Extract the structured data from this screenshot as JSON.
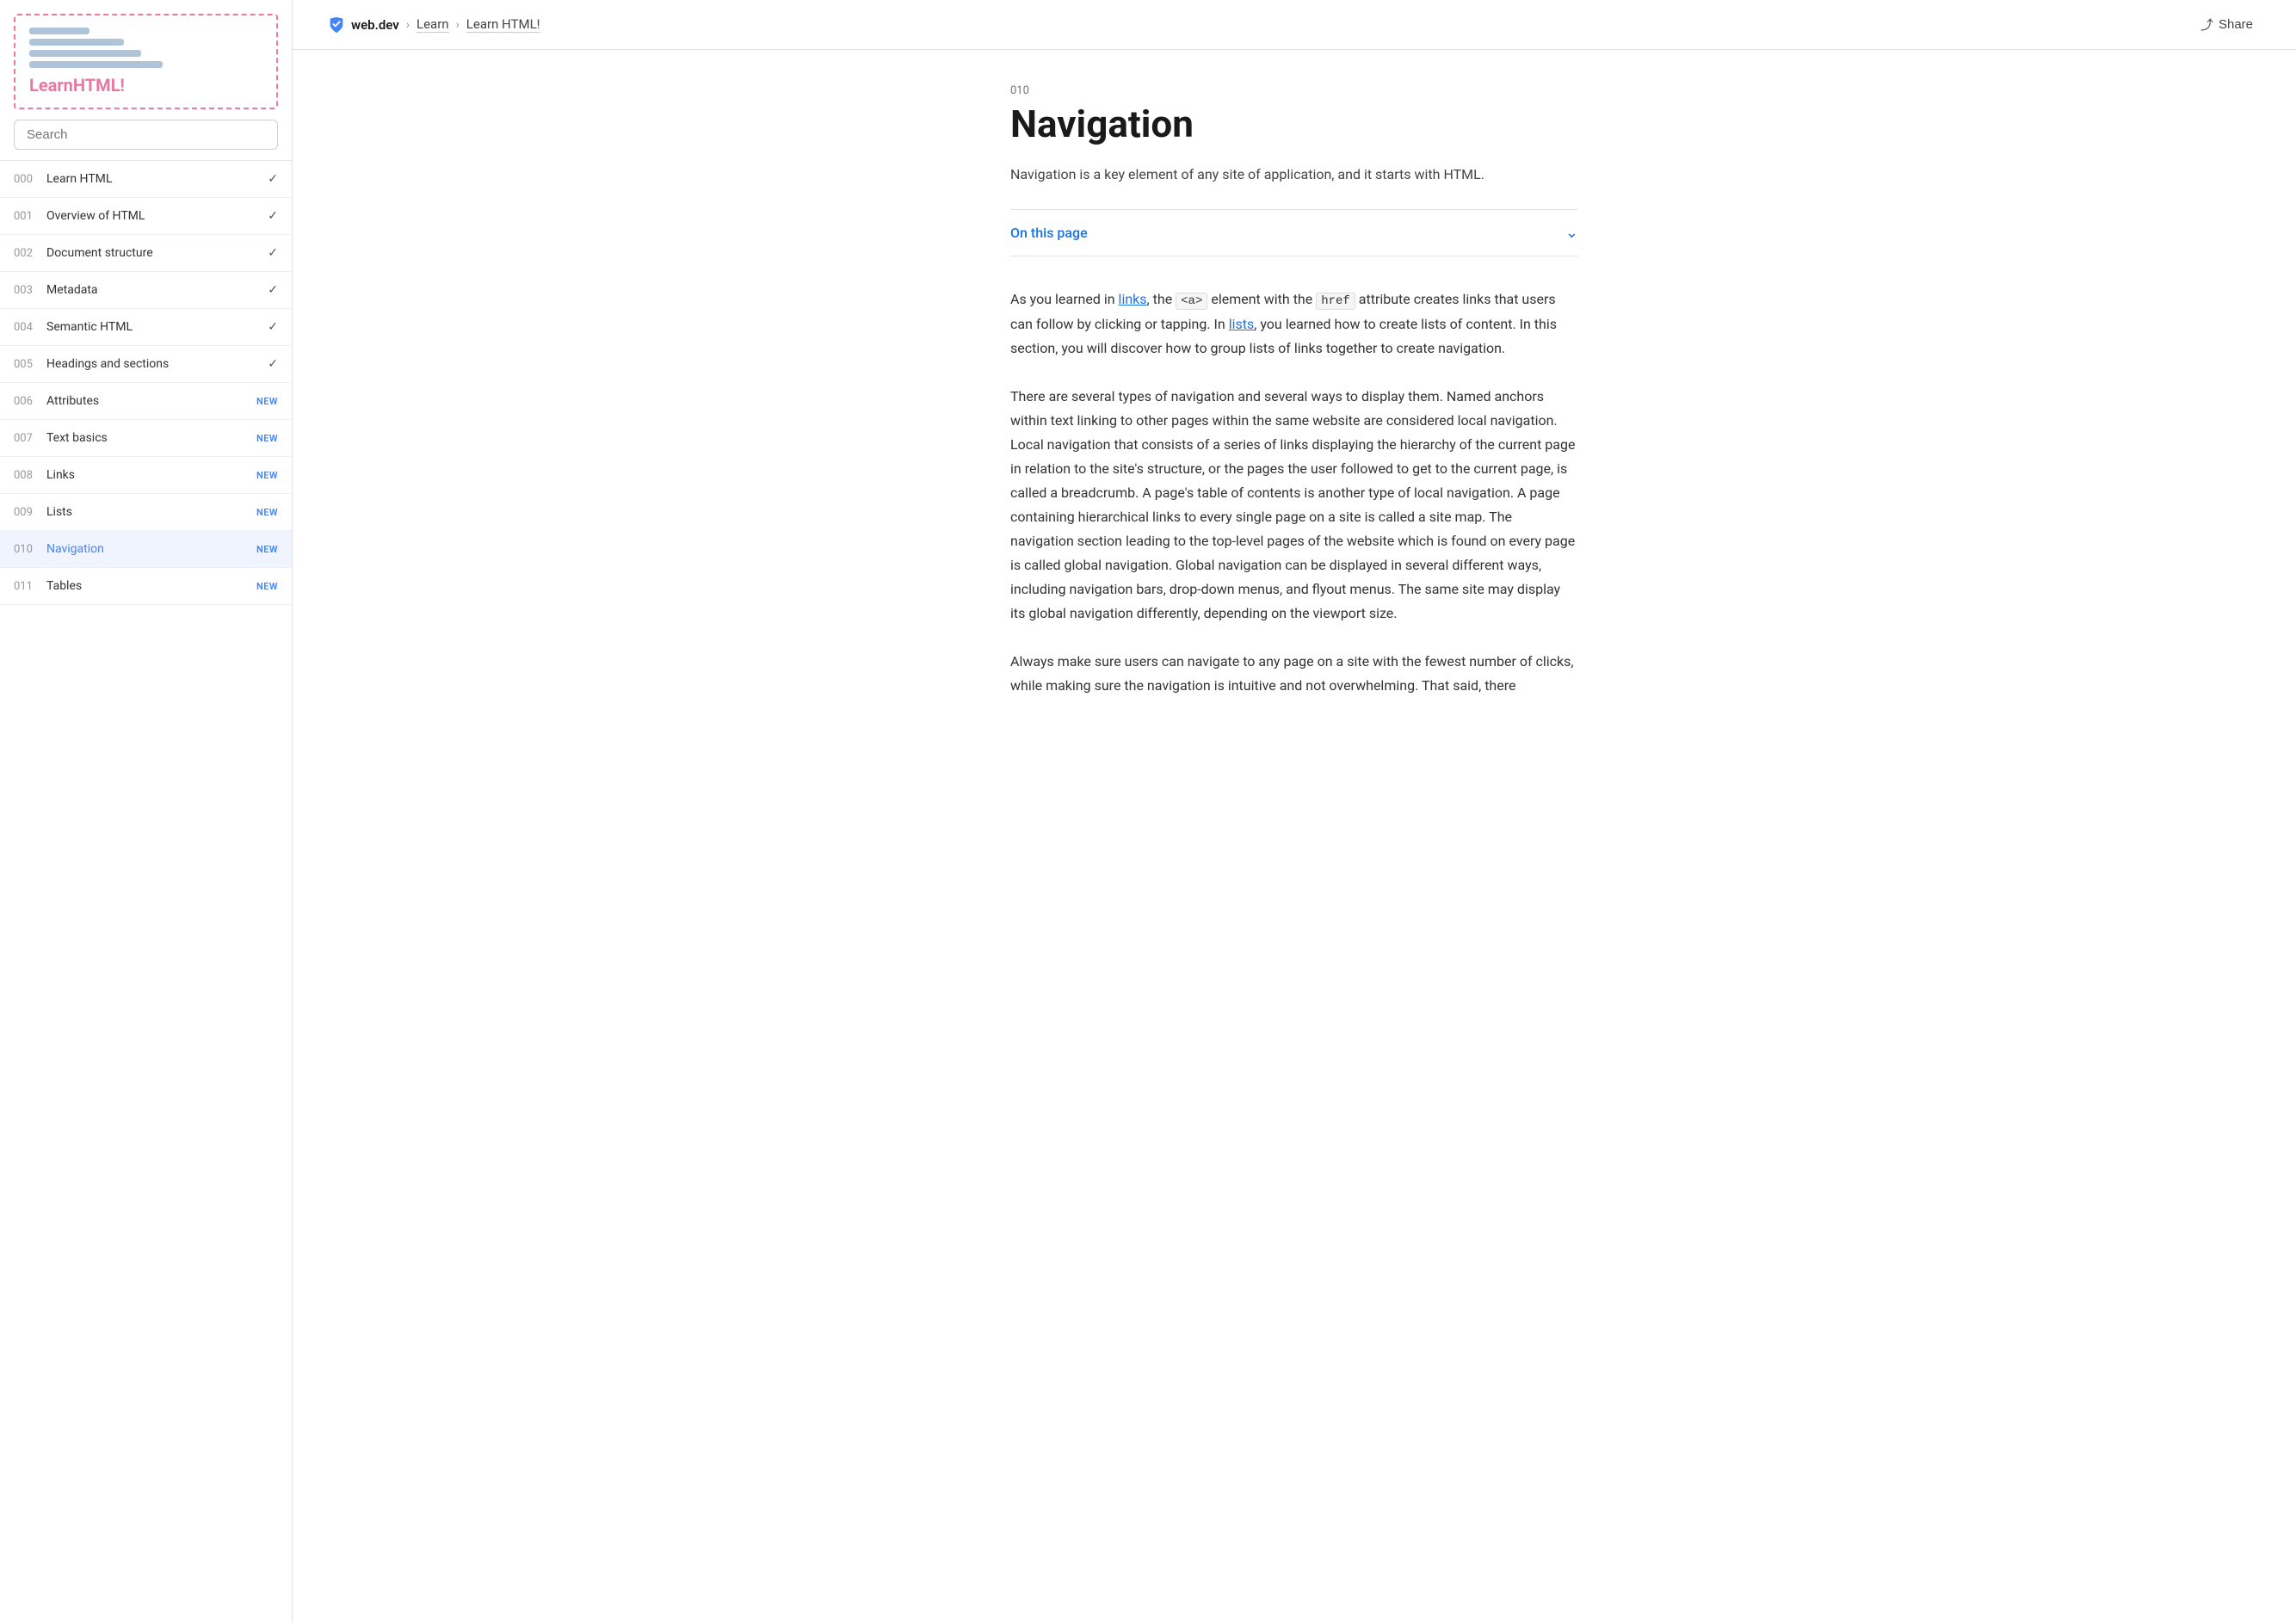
{
  "sidebar": {
    "logo": {
      "text_before": "Learn",
      "text_highlight": "HTML!",
      "preview_lines": [
        {
          "width": 70,
          "class": "short"
        },
        {
          "width": 100,
          "class": "medium"
        },
        {
          "width": 130,
          "class": "long"
        },
        {
          "width": 150,
          "class": "xlong"
        }
      ]
    },
    "search_placeholder": "Search",
    "nav_items": [
      {
        "num": "000",
        "label": "Learn HTML",
        "badge": "",
        "check": true
      },
      {
        "num": "001",
        "label": "Overview of HTML",
        "badge": "",
        "check": true
      },
      {
        "num": "002",
        "label": "Document structure",
        "badge": "",
        "check": true
      },
      {
        "num": "003",
        "label": "Metadata",
        "badge": "",
        "check": true
      },
      {
        "num": "004",
        "label": "Semantic HTML",
        "badge": "",
        "check": true
      },
      {
        "num": "005",
        "label": "Headings and sections",
        "badge": "",
        "check": true
      },
      {
        "num": "006",
        "label": "Attributes",
        "badge": "NEW",
        "check": false
      },
      {
        "num": "007",
        "label": "Text basics",
        "badge": "NEW",
        "check": false
      },
      {
        "num": "008",
        "label": "Links",
        "badge": "NEW",
        "check": false
      },
      {
        "num": "009",
        "label": "Lists",
        "badge": "NEW",
        "check": false
      },
      {
        "num": "010",
        "label": "Navigation",
        "badge": "NEW",
        "check": false,
        "active": true
      },
      {
        "num": "011",
        "label": "Tables",
        "badge": "NEW",
        "check": false
      }
    ]
  },
  "topbar": {
    "site": "web.dev",
    "breadcrumb_sep1": ">",
    "learn_label": "Learn",
    "breadcrumb_sep2": ">",
    "current": "Learn HTML!",
    "share_label": "Share"
  },
  "content": {
    "lesson_num": "010",
    "title": "Navigation",
    "subtitle": "Navigation is a key element of any site of application, and it starts with HTML.",
    "on_this_page": "On this page",
    "paragraphs": [
      "As you learned in links, the <a> element with the href attribute creates links that users can follow by clicking or tapping. In lists, you learned how to create lists of content. In this section, you will discover how to group lists of links together to create navigation.",
      "There are several types of navigation and several ways to display them. Named anchors within text linking to other pages within the same website are considered local navigation. Local navigation that consists of a series of links displaying the hierarchy of the current page in relation to the site's structure, or the pages the user followed to get to the current page, is called a breadcrumb. A page's table of contents is another type of local navigation. A page containing hierarchical links to every single page on a site is called a site map. The navigation section leading to the top-level pages of the website which is found on every page is called global navigation. Global navigation can be displayed in several different ways, including navigation bars, drop-down menus, and flyout menus. The same site may display its global navigation differently, depending on the viewport size.",
      "Always make sure users can navigate to any page on a site with the fewest number of clicks, while making sure the navigation is intuitive and not overwhelming. That said, there"
    ]
  }
}
